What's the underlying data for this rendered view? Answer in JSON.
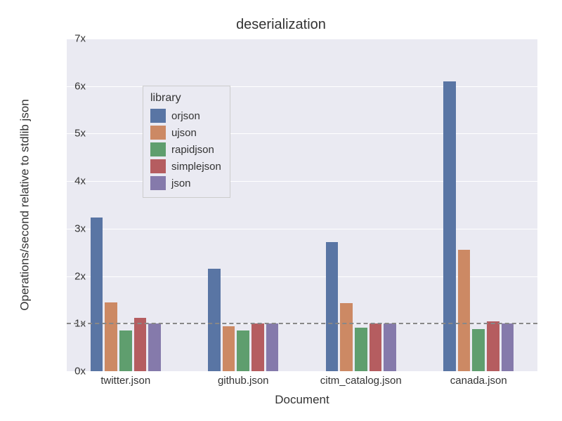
{
  "chart_data": {
    "type": "bar",
    "title": "deserialization",
    "xlabel": "Document",
    "ylabel": "Operations/second relative to stdlib json",
    "ylim": [
      0,
      7
    ],
    "yticks": [
      0,
      1,
      2,
      3,
      4,
      5,
      6,
      7
    ],
    "ytick_labels": [
      "0x",
      "1x",
      "2x",
      "3x",
      "4x",
      "5x",
      "6x",
      "7x"
    ],
    "baseline": 1,
    "categories": [
      "twitter.json",
      "github.json",
      "citm_catalog.json",
      "canada.json"
    ],
    "legend_title": "library",
    "series": [
      {
        "name": "orjson",
        "color": "#5975a4",
        "values": [
          3.24,
          2.15,
          2.72,
          6.1
        ]
      },
      {
        "name": "ujson",
        "color": "#cc8964",
        "values": [
          1.45,
          0.94,
          1.43,
          2.55
        ]
      },
      {
        "name": "rapidjson",
        "color": "#5f9e6e",
        "values": [
          0.85,
          0.86,
          0.92,
          0.89
        ]
      },
      {
        "name": "simplejson",
        "color": "#b55d60",
        "values": [
          1.12,
          1.0,
          1.0,
          1.05
        ]
      },
      {
        "name": "json",
        "color": "#857aab",
        "values": [
          1.0,
          1.0,
          1.0,
          1.0
        ]
      }
    ]
  }
}
